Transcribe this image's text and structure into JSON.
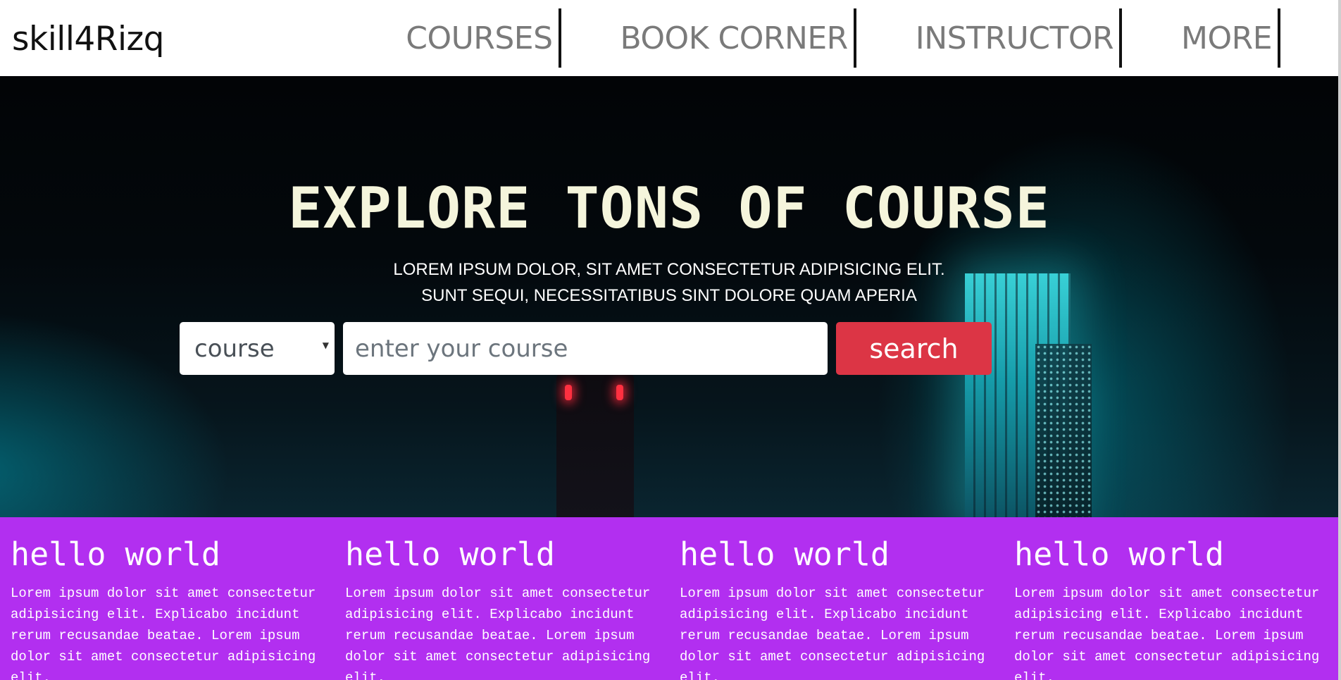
{
  "navbar": {
    "brand": "skill4Rizq",
    "links": [
      {
        "label": "COURSES"
      },
      {
        "label": "BOOK CORNER"
      },
      {
        "label": "INSTRUCTOR"
      },
      {
        "label": "MORE"
      }
    ]
  },
  "hero": {
    "title": "EXPLORE TONS OF COURSE",
    "subtitle_line1": "LOREM IPSUM DOLOR, SIT AMET CONSECTETUR ADIPISICING ELIT.",
    "subtitle_line2": "SUNT SEQUI, NECESSITATIBUS SINT DOLORE QUAM APERIA",
    "select_value": "course",
    "search_placeholder": "enter your course",
    "search_button": "search"
  },
  "cards": [
    {
      "title": "hello world",
      "text": "Lorem ipsum dolor sit amet consectetur adipisicing elit. Explicabo incidunt rerum recusandae beatae. Lorem ipsum dolor sit amet consectetur adipisicing elit."
    },
    {
      "title": "hello world",
      "text": "Lorem ipsum dolor sit amet consectetur adipisicing elit. Explicabo incidunt rerum recusandae beatae. Lorem ipsum dolor sit amet consectetur adipisicing elit."
    },
    {
      "title": "hello world",
      "text": "Lorem ipsum dolor sit amet consectetur adipisicing elit. Explicabo incidunt rerum recusandae beatae. Lorem ipsum dolor sit amet consectetur adipisicing elit."
    },
    {
      "title": "hello world",
      "text": "Lorem ipsum dolor sit amet consectetur adipisicing elit. Explicabo incidunt rerum recusandae beatae. Lorem ipsum dolor sit amet consectetur adipisicing elit."
    }
  ],
  "colors": {
    "brand_text": "#111111",
    "nav_text": "#7a7a7a",
    "hero_title": "#f5f5dc",
    "search_button": "#dc3545",
    "cards_background": "#b22ff0"
  }
}
